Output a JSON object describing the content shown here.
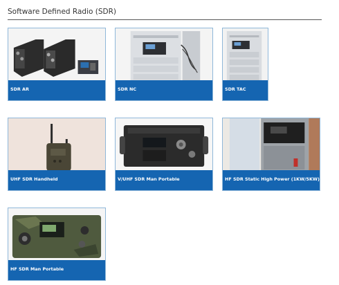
{
  "section": {
    "title": "Software Defined Radio (SDR)"
  },
  "products": [
    {
      "label": "SDR AR",
      "image_icon": "radio-rack-units-photo"
    },
    {
      "label": "SDR NC",
      "image_icon": "radio-cabinet-photo"
    },
    {
      "label": "SDR TAC",
      "image_icon": "radio-cabinet-photo"
    },
    {
      "label": "UHF SDR Handheld",
      "image_icon": "handheld-radio-photo"
    },
    {
      "label": "V/UHF SDR Man Portable",
      "image_icon": "manpack-radio-photo"
    },
    {
      "label": "HF SDR Static High Power (1KW/5KW)",
      "image_icon": "radio-cabinet-photo"
    },
    {
      "label": "HF SDR Man Portable",
      "image_icon": "manpack-radio-photo"
    }
  ],
  "colors": {
    "caption_bg": "#1565b1",
    "card_border": "#8fb7d9",
    "rule": "#555555"
  }
}
